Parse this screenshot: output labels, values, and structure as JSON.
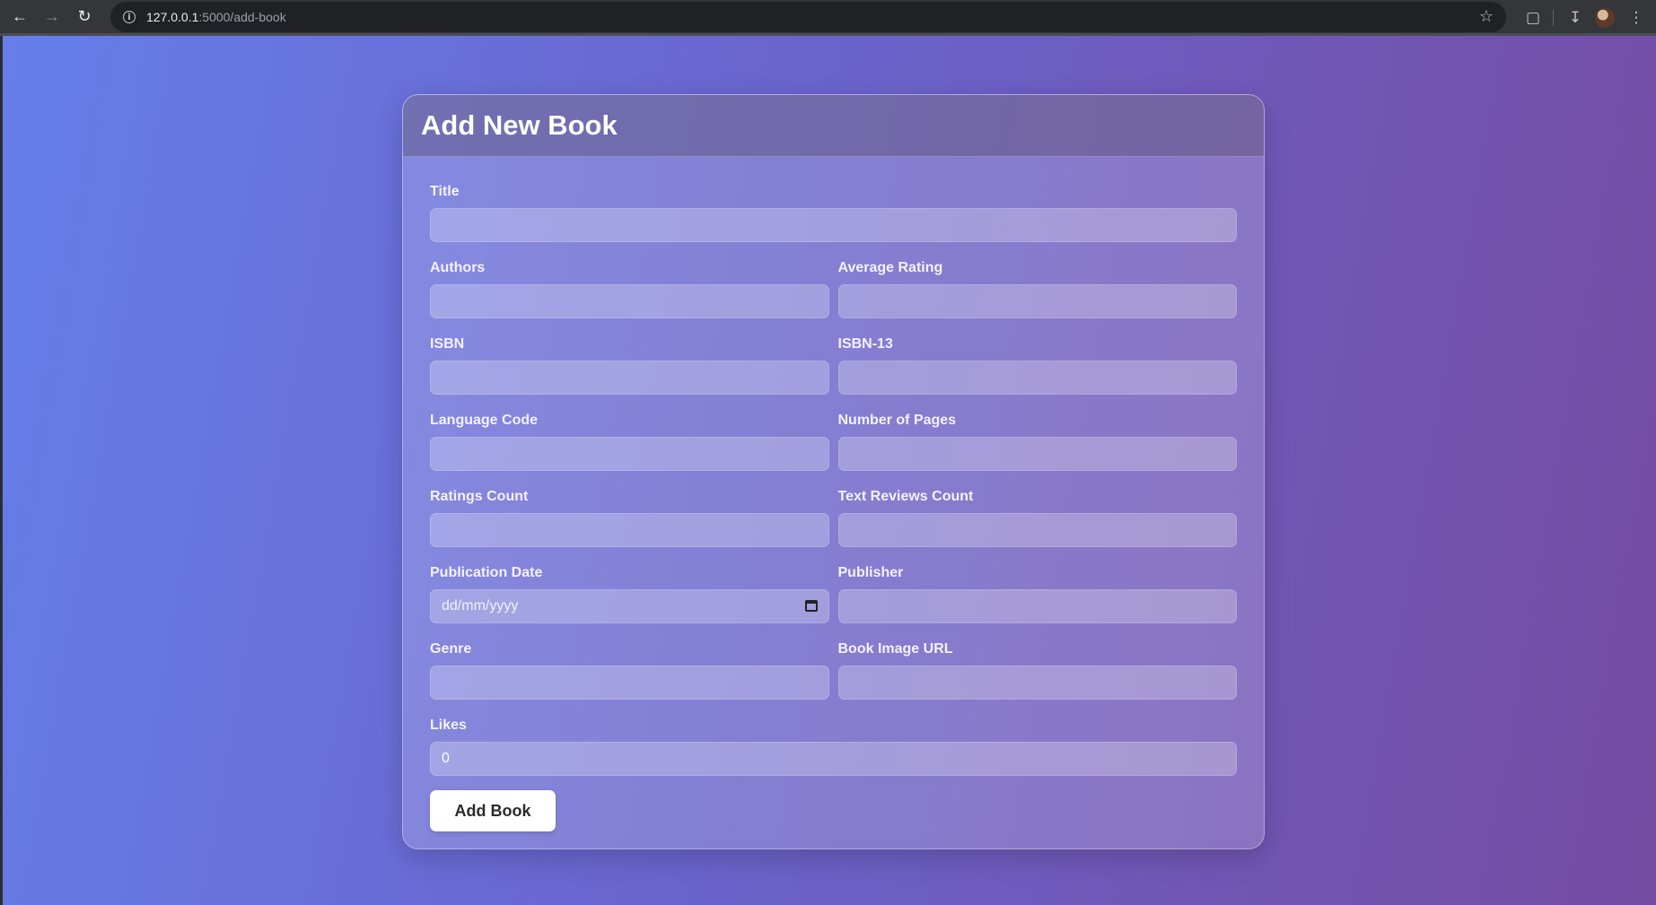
{
  "browser": {
    "url_host": "127.0.0.1",
    "url_path": ":5000/add-book",
    "icons": [
      "back-arrow-icon",
      "forward-arrow-icon",
      "reload-icon",
      "info-icon",
      "star-icon",
      "extensions-icon",
      "download-icon",
      "profile-avatar",
      "kebab-menu-icon"
    ]
  },
  "card": {
    "title": "Add New Book"
  },
  "form": {
    "title": {
      "label": "Title",
      "value": ""
    },
    "authors": {
      "label": "Authors",
      "value": ""
    },
    "average_rating": {
      "label": "Average Rating",
      "value": ""
    },
    "isbn": {
      "label": "ISBN",
      "value": ""
    },
    "isbn13": {
      "label": "ISBN-13",
      "value": ""
    },
    "language_code": {
      "label": "Language Code",
      "value": ""
    },
    "num_pages": {
      "label": "Number of Pages",
      "value": ""
    },
    "ratings_count": {
      "label": "Ratings Count",
      "value": ""
    },
    "text_reviews_count": {
      "label": "Text Reviews Count",
      "value": ""
    },
    "publication_date": {
      "label": "Publication Date",
      "placeholder": "dd/mm/yyyy"
    },
    "publisher": {
      "label": "Publisher",
      "value": ""
    },
    "genre": {
      "label": "Genre",
      "value": ""
    },
    "image_url": {
      "label": "Book Image URL",
      "value": ""
    },
    "likes": {
      "label": "Likes",
      "value": "0"
    },
    "submit_label": "Add Book"
  },
  "colors": {
    "gradient_start": "#667eea",
    "gradient_end": "#764ba2",
    "button_bg": "#ffffff"
  }
}
